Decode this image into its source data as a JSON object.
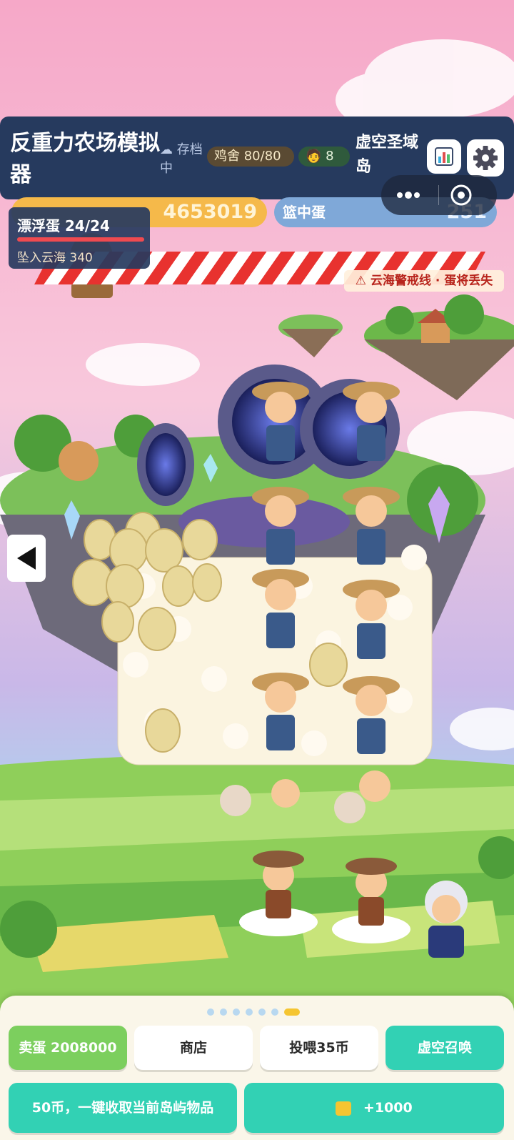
{
  "header": {
    "title": "反重力农场模拟器",
    "save_status": "存档中",
    "coop": "鸡舍 80/80",
    "workers": "8",
    "island": "虚空圣域岛"
  },
  "resources": {
    "coins": "4653019",
    "basket_label": "篮中蛋",
    "basket_value": "251"
  },
  "float_panel": {
    "count": "漂浮蛋 24/24",
    "progress": 1.0,
    "fallen": "坠入云海 340"
  },
  "warning": "云海警戒线 · 蛋将丢失",
  "bottom": {
    "page_dots": 7,
    "active_dot": 6,
    "sell": "卖蛋 2008000",
    "shop": "商店",
    "feed": "投喂35币",
    "summon": "虚空召唤",
    "collect": "50币，一键收取当前岛屿物品",
    "bonus": "+1000"
  },
  "colors": {
    "topbar": "#263a5e",
    "accent": "#32d1b4",
    "sell": "#7ccf5e",
    "coin": "#f5b94a",
    "warning": "#b8241c"
  }
}
